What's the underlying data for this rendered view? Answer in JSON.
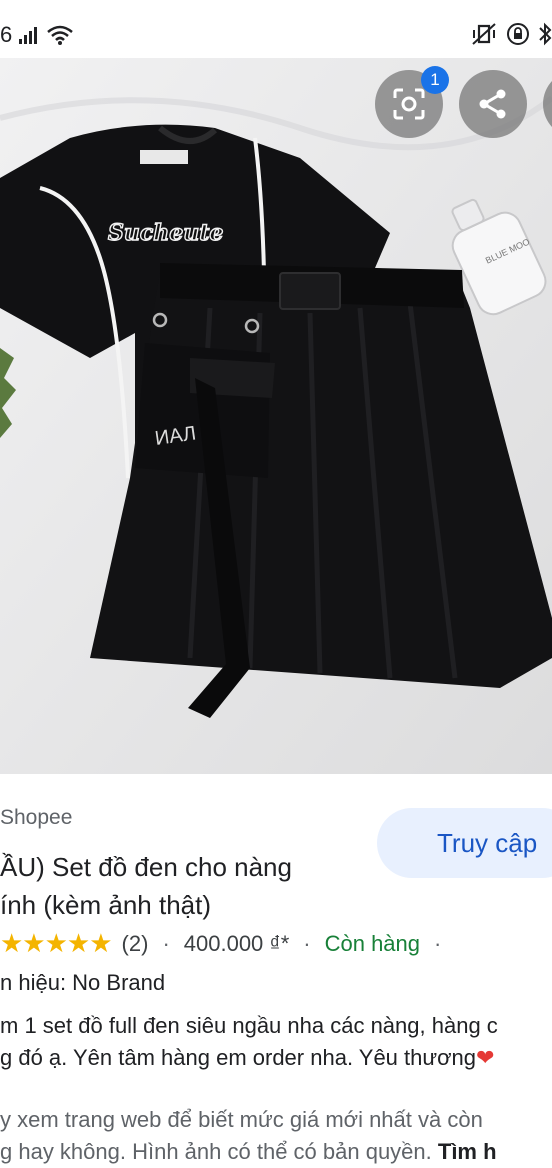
{
  "status_bar": {
    "time_fragment": "6"
  },
  "lens": {
    "badge_count": "1"
  },
  "photo": {
    "shirt_text": "Sucheute",
    "bag_text": "ИАЛ",
    "bottle_text": "BLUE MOO"
  },
  "result": {
    "source": "Shopee",
    "visit_label": "Truy cập",
    "title_line1": "ẦU) Set đồ đen cho nàng",
    "title_line2": "ính (kèm ảnh thật)",
    "stars": "★★★★★",
    "rating_count": "(2)",
    "price": "400.000 ₫*",
    "stock": "Còn hàng",
    "brand": "n hiệu: No Brand",
    "desc_line1": "m 1 set đồ full đen siêu ngầu nha các nàng, hàng c",
    "desc_line2": "g đó ạ. Yên tâm hàng em order nha. Yêu thương",
    "heart": "❤",
    "note_line1": "y xem trang web để biết mức giá mới nhất và còn",
    "note_line2": "g hay không. Hình ảnh có thể có bản quyền. ",
    "note_link": "Tìm h"
  },
  "colors": {
    "accent": "#1a73e8",
    "visit_bg": "#e8f0fe",
    "stock_green": "#188038",
    "star": "#f4b400"
  }
}
